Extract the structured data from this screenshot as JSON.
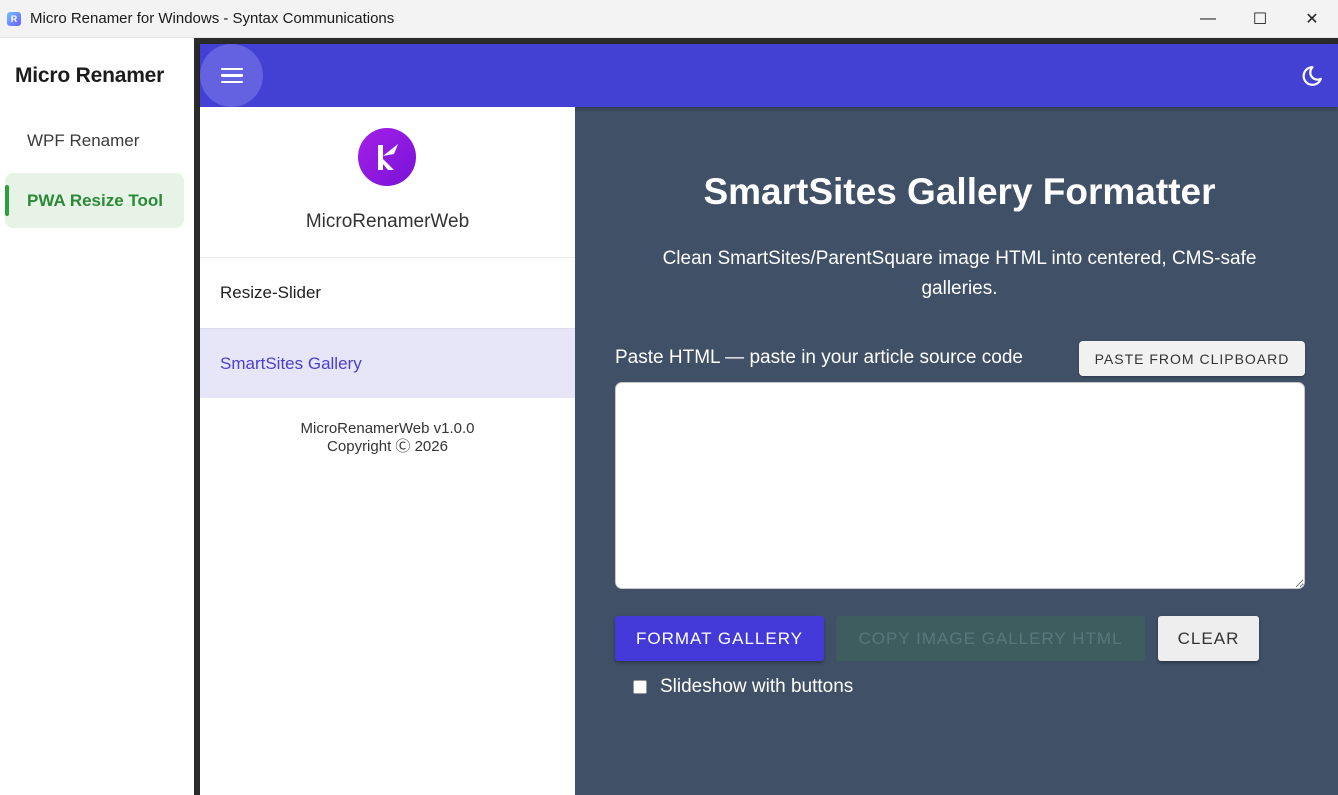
{
  "window": {
    "title": "Micro Renamer for Windows - Syntax Communications",
    "icon_letter": "R",
    "controls": {
      "minimize": "—",
      "maximize": "☐",
      "close": "✕"
    }
  },
  "native_sidebar": {
    "title": "Micro Renamer",
    "items": [
      {
        "label": "WPF Renamer",
        "selected": false
      },
      {
        "label": "PWA Resize Tool",
        "selected": true
      }
    ]
  },
  "topbar": {
    "menu_icon": "hamburger-icon",
    "theme_icon": "moon-icon",
    "color": "#4340d4"
  },
  "drawer": {
    "app_name": "MicroRenamerWeb",
    "nav": [
      {
        "label": "Resize-Slider",
        "active": false
      },
      {
        "label": "SmartSites Gallery",
        "active": true
      }
    ],
    "version_line1": "MicroRenamerWeb v1.0.0",
    "version_line2": "Copyright Ⓒ 2026"
  },
  "main": {
    "title": "SmartSites Gallery Formatter",
    "subtitle": "Clean SmartSites/ParentSquare image HTML into centered, CMS-safe galleries.",
    "paste_label": "Paste HTML — paste in your article source code",
    "paste_button": "PASTE FROM CLIPBOARD",
    "textarea_value": "",
    "buttons": {
      "format": "FORMAT GALLERY",
      "copy": "COPY IMAGE GALLERY HTML",
      "clear": "CLEAR"
    },
    "slideshow_label": "Slideshow with buttons",
    "slideshow_checked": false
  },
  "colors": {
    "accent": "#4340d4",
    "content_bg": "#405066",
    "sidebar_selected_text": "#2a8a35"
  }
}
